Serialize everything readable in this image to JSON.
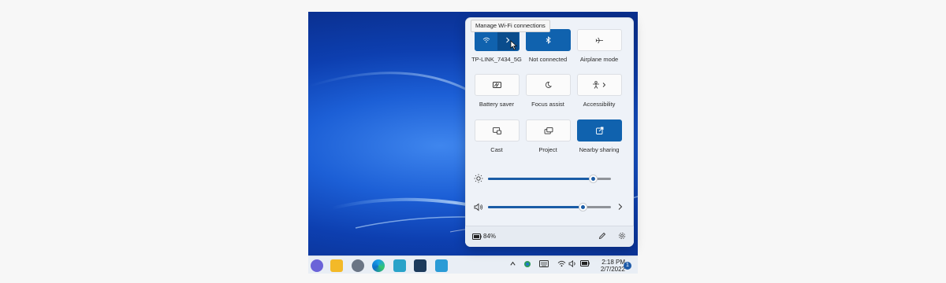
{
  "tooltip": {
    "text": "Manage Wi-Fi connections"
  },
  "quick_settings": {
    "tiles": [
      {
        "label": "TP-LINK_7434_5G",
        "icon": "wifi-icon",
        "active": true
      },
      {
        "label": "Not connected",
        "icon": "bluetooth-icon",
        "active": true
      },
      {
        "label": "Airplane mode",
        "icon": "airplane-icon",
        "active": false
      },
      {
        "label": "Battery saver",
        "icon": "battery-saver-icon",
        "active": false
      },
      {
        "label": "Focus assist",
        "icon": "moon-icon",
        "active": false
      },
      {
        "label": "Accessibility",
        "icon": "accessibility-icon",
        "active": false
      },
      {
        "label": "Cast",
        "icon": "cast-icon",
        "active": false
      },
      {
        "label": "Project",
        "icon": "project-icon",
        "active": false
      },
      {
        "label": "Nearby sharing",
        "icon": "share-icon",
        "active": true
      }
    ],
    "brightness": {
      "icon": "sun-icon",
      "level": 0.85
    },
    "volume": {
      "icon": "speaker-icon",
      "level": 0.77
    },
    "battery_percent": "84%"
  },
  "taskbar": {
    "apps": [
      "teams-icon",
      "file-explorer-icon",
      "settings-icon",
      "edge-icon",
      "store-icon",
      "app-icon",
      "photos-icon"
    ],
    "tray": [
      "chevron-up-icon",
      "security-icon",
      "keyboard-icon",
      "wifi-icon",
      "speaker-icon",
      "battery-icon"
    ],
    "time": "2:18 PM",
    "date": "2/7/2022",
    "notification_count": "1"
  },
  "colors": {
    "accent": "#1062ae",
    "wallpaper": "#1c5fd6"
  }
}
